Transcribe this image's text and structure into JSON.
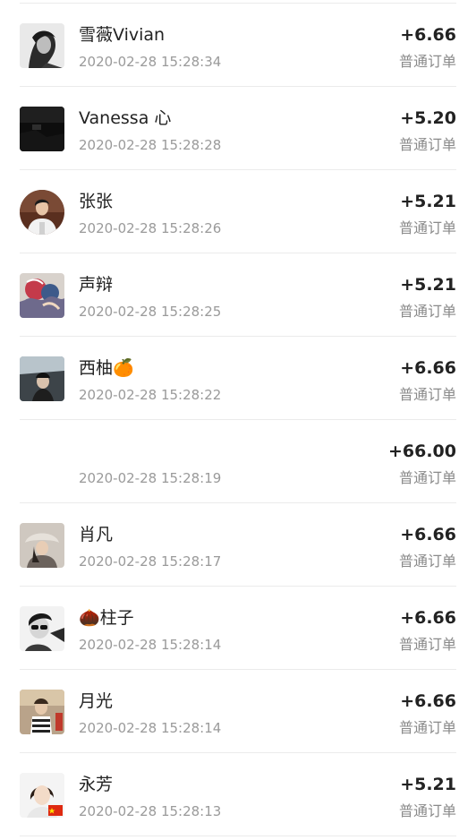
{
  "orders": [
    {
      "name": "雪薇Vivian",
      "time": "2020-02-28 15:28:34",
      "amount": "+6.66",
      "type": "普通订单",
      "avatar": "avatar-bw-portrait"
    },
    {
      "name": "Vanessa 心",
      "time": "2020-02-28 15:28:28",
      "amount": "+5.20",
      "type": "普通订单",
      "avatar": "avatar-dark-scene"
    },
    {
      "name": "张张",
      "time": "2020-02-28 15:28:26",
      "amount": "+5.21",
      "type": "普通订单",
      "avatar": "avatar-man-white-shirt"
    },
    {
      "name": "声辩",
      "time": "2020-02-28 15:28:25",
      "amount": "+5.21",
      "type": "普通订单",
      "avatar": "avatar-colorful-art"
    },
    {
      "name": "西柚🍊",
      "time": "2020-02-28 15:28:22",
      "amount": "+6.66",
      "type": "普通订单",
      "avatar": "avatar-person-in-car"
    },
    {
      "name": "",
      "time": "2020-02-28 15:28:19",
      "amount": "+66.00",
      "type": "普通订单",
      "avatar": ""
    },
    {
      "name": "肖凡",
      "time": "2020-02-28 15:28:17",
      "amount": "+6.66",
      "type": "普通订单",
      "avatar": "avatar-woman-hat"
    },
    {
      "name": "🌰柱子",
      "time": "2020-02-28 15:28:14",
      "amount": "+6.66",
      "type": "普通订单",
      "avatar": "avatar-bw-sunglasses"
    },
    {
      "name": "月光",
      "time": "2020-02-28 15:28:14",
      "amount": "+6.66",
      "type": "普通订单",
      "avatar": "avatar-child-striped"
    },
    {
      "name": "永芳",
      "time": "2020-02-28 15:28:13",
      "amount": "+5.21",
      "type": "普通订单",
      "avatar": "avatar-woman-flag"
    }
  ]
}
